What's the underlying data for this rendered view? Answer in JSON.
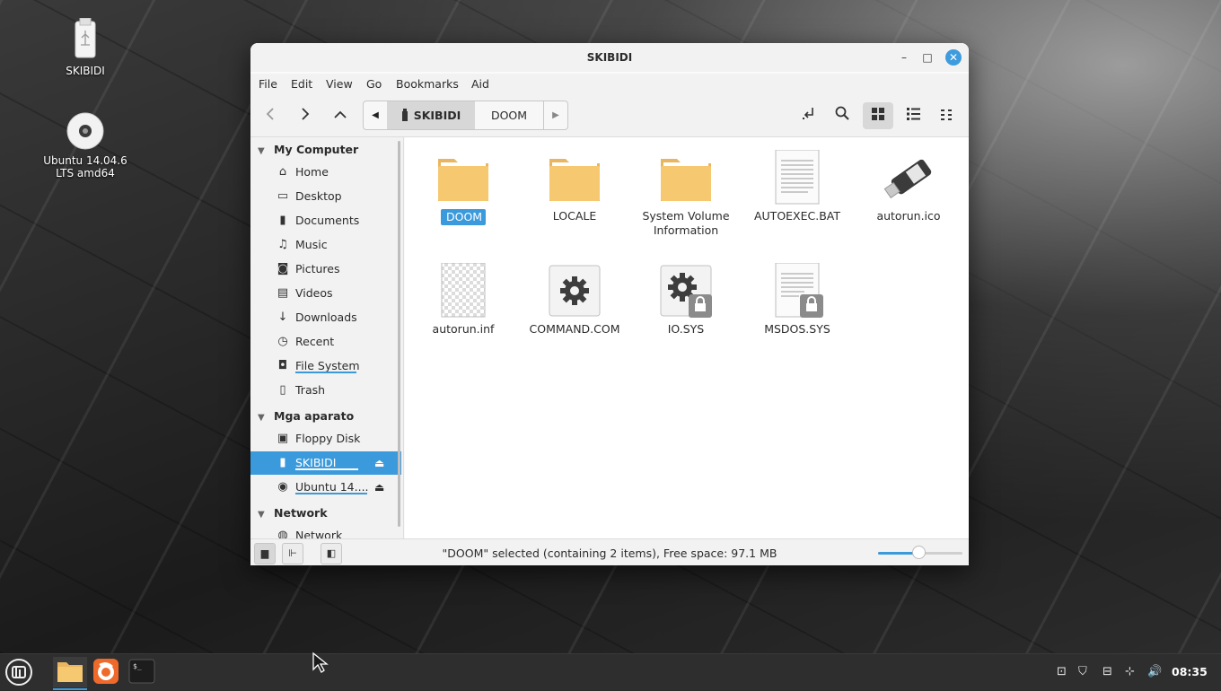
{
  "desktop": {
    "icons": [
      {
        "label": "SKIBIDI",
        "icon": "usb-drive-icon"
      },
      {
        "label": "Ubuntu 14.04.6\nLTS amd64",
        "label_line1": "Ubuntu 14.04.6",
        "label_line2": "LTS amd64",
        "icon": "optical-disc-icon"
      }
    ]
  },
  "window": {
    "title": "SKIBIDI",
    "controls": {
      "minimize": "–",
      "maximize": "□",
      "close": "✕"
    }
  },
  "menubar": [
    "File",
    "Edit",
    "View",
    "Go",
    "Bookmarks",
    "Aid"
  ],
  "toolbar": {
    "back": "back-icon",
    "forward": "forward-icon",
    "up": "up-icon",
    "pathbar": [
      "SKIBIDI",
      "DOOM"
    ],
    "actions": [
      "open-in-terminal-icon",
      "search-icon",
      "icon-view-icon",
      "list-view-icon",
      "compact-view-icon"
    ]
  },
  "sidebar": {
    "sections": [
      {
        "title": "My Computer",
        "items": [
          "Home",
          "Desktop",
          "Documents",
          "Music",
          "Pictures",
          "Videos",
          "Downloads",
          "Recent",
          "File System",
          "Trash"
        ]
      },
      {
        "title": "Mga aparato",
        "items": [
          "Floppy Disk",
          "SKIBIDI",
          "Ubuntu 14...."
        ]
      },
      {
        "title": "Network",
        "items": [
          "Network"
        ]
      }
    ],
    "selected": "SKIBIDI"
  },
  "files": [
    {
      "name": "DOOM",
      "type": "folder",
      "selected": true
    },
    {
      "name": "LOCALE",
      "type": "folder"
    },
    {
      "name_line1": "System Volume",
      "name_line2": "Information",
      "type": "folder"
    },
    {
      "name": "AUTOEXEC.BAT",
      "type": "text"
    },
    {
      "name": "autorun.ico",
      "type": "usb-image"
    },
    {
      "name": "autorun.inf",
      "type": "blank"
    },
    {
      "name": "COMMAND.COM",
      "type": "executable"
    },
    {
      "name": "IO.SYS",
      "type": "executable-locked"
    },
    {
      "name": "MSDOS.SYS",
      "type": "text-locked"
    }
  ],
  "statusbar": {
    "text": "\"DOOM\" selected (containing 2 items), Free space: 97.1 MB",
    "zoom_level": 0.48
  },
  "taskbar": {
    "clock": "08:35",
    "apps": [
      "menu-icon",
      "files-icon",
      "firefox-icon",
      "terminal-icon"
    ],
    "terminal_glyph": "$_"
  },
  "colors": {
    "accent": "#3b9adb",
    "folder": "#f6c870",
    "taskbar": "#2e2e2e"
  }
}
